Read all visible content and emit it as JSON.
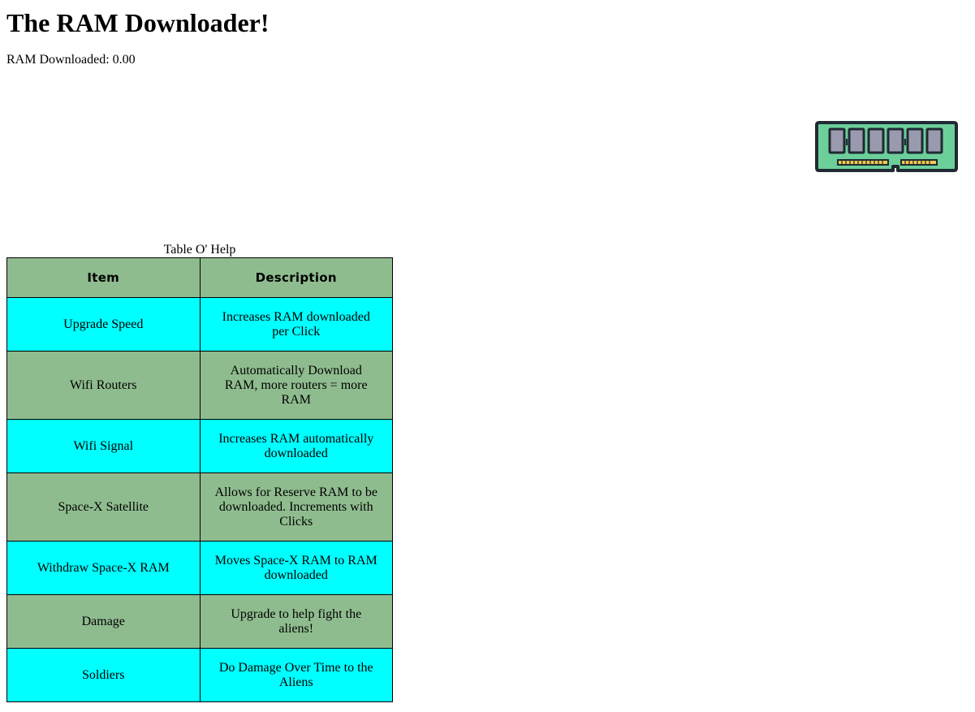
{
  "header": {
    "title": "The RAM Downloader!",
    "counter_label": "RAM Downloaded: 0.00"
  },
  "ram_button": {
    "icon": "ram-stick-icon",
    "colors": {
      "board": "#6ccf9a",
      "chips": "#9a9aae",
      "contacts": "#f2c94c",
      "outline": "#1f2a33"
    }
  },
  "help_table": {
    "caption": "Table O' Help",
    "headers": [
      "Item",
      "Description"
    ],
    "rows": [
      {
        "item": "Upgrade Speed",
        "description": "Increases RAM downloaded per Click"
      },
      {
        "item": "Wifi Routers",
        "description": "Automatically Download RAM, more routers = more RAM"
      },
      {
        "item": "Wifi Signal",
        "description": "Increases RAM automatically downloaded"
      },
      {
        "item": "Space-X Satellite",
        "description": "Allows for Reserve RAM to be downloaded. Increments with Clicks"
      },
      {
        "item": "Withdraw Space-X RAM",
        "description": "Moves Space-X RAM to RAM downloaded"
      },
      {
        "item": "Damage",
        "description": "Upgrade to help fight the aliens!"
      },
      {
        "item": "Soldiers",
        "description": "Do Damage Over Time to the Aliens"
      }
    ],
    "colors": {
      "header_bg": "#8fbc8f",
      "row_cyan": "#00ffff",
      "row_green": "#8fbc8f"
    }
  }
}
